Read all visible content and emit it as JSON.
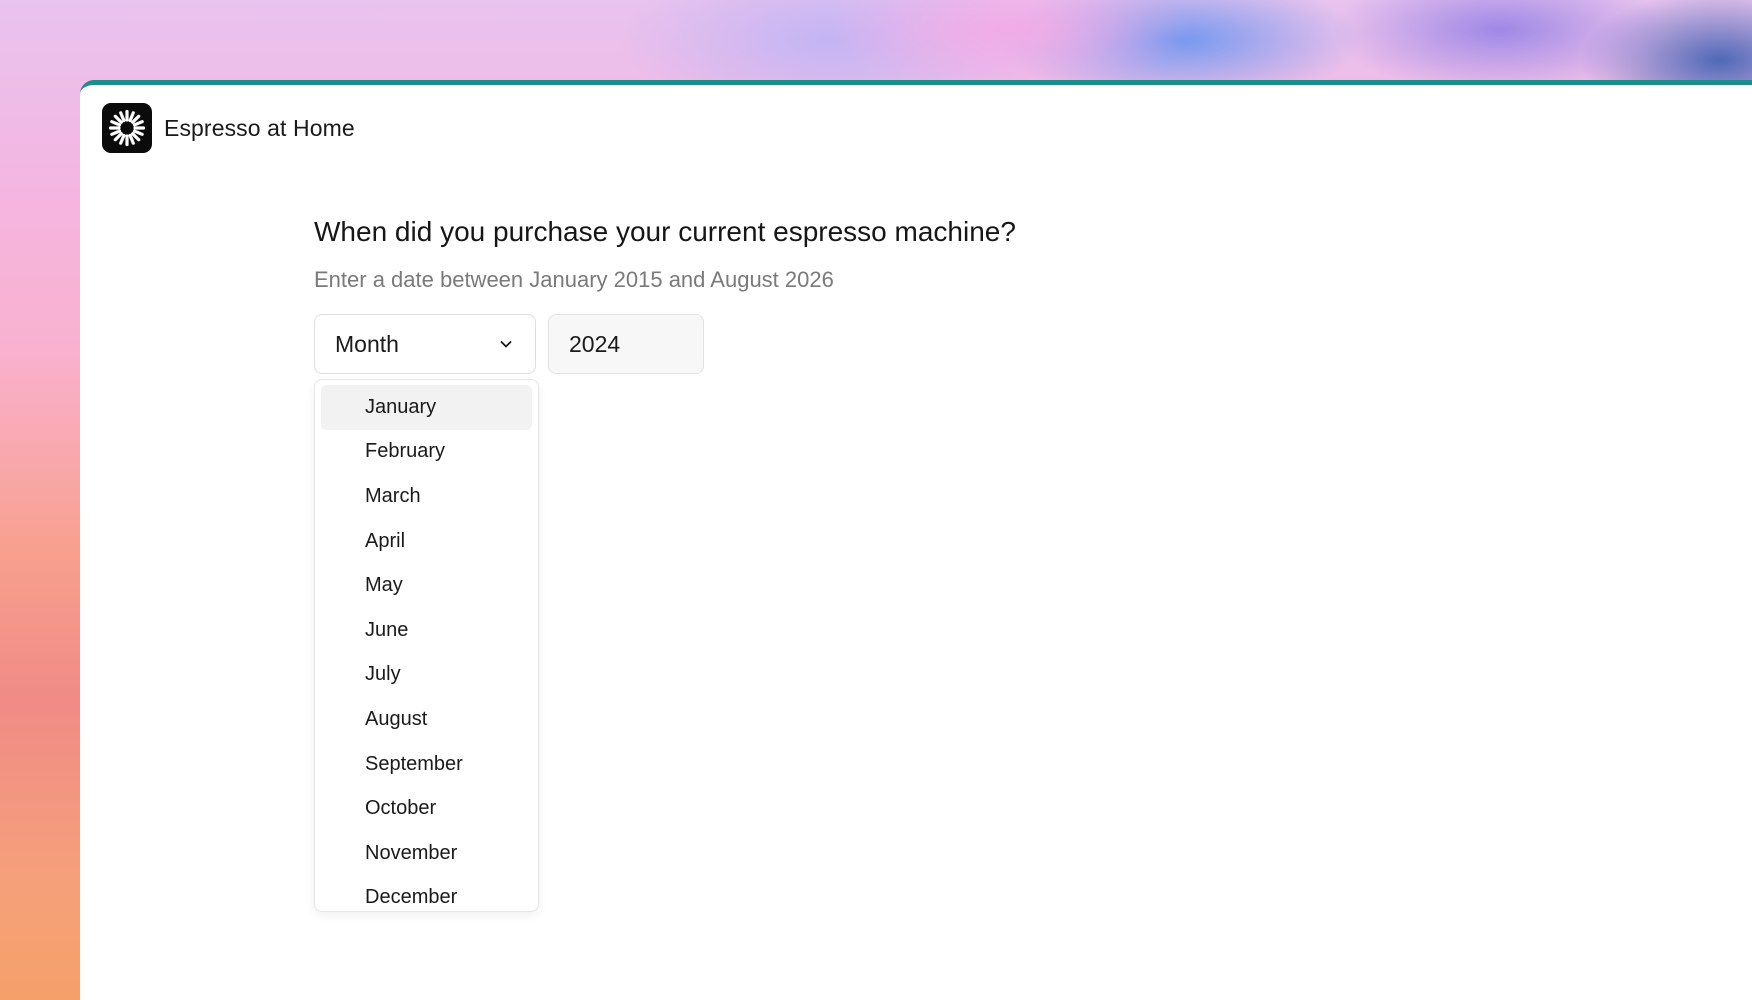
{
  "app": {
    "name": "Espresso at Home",
    "logo_icon": "sunburst-logo-icon"
  },
  "form": {
    "question": "When did you purchase your current espresso machine?",
    "hint": "Enter a date between January 2015 and August 2026",
    "month_select": {
      "label": "Month",
      "icon": "chevron-down-icon"
    },
    "year_input": {
      "value": "2024"
    }
  },
  "dropdown": {
    "highlighted_index": 0,
    "options": [
      "January",
      "February",
      "March",
      "April",
      "May",
      "June",
      "July",
      "August",
      "September",
      "October",
      "November",
      "December"
    ]
  },
  "colors": {
    "accent_border": "#1d8c8a",
    "logo_background": "#0b0b0b"
  }
}
